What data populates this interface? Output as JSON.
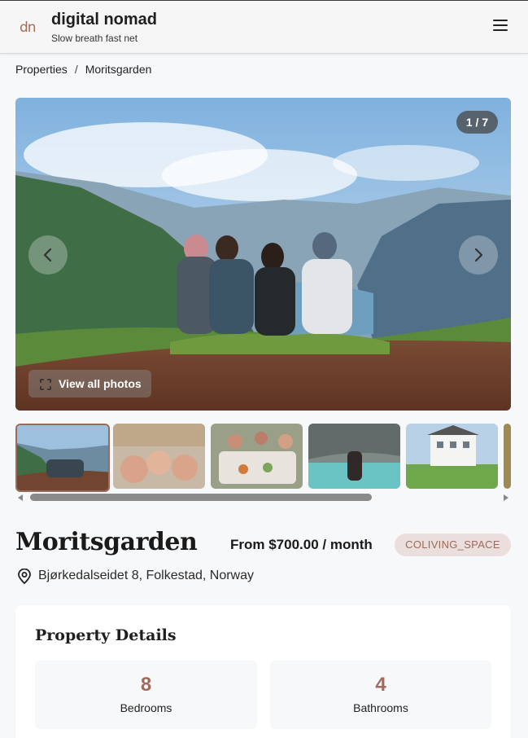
{
  "brand": {
    "logo_text": "dn",
    "name": "digital nomad",
    "tagline": "Slow breath fast net"
  },
  "breadcrumb": {
    "parent": "Properties",
    "separator": "/",
    "current": "Moritsgarden"
  },
  "gallery": {
    "counter": "1 / 7",
    "view_all_label": "View all photos",
    "thumbnails": [
      "mountain-view-group",
      "selfie-group",
      "dinner-table",
      "lake-couple",
      "house-exterior",
      "partial-thumb"
    ]
  },
  "property": {
    "title": "Moritsgarden",
    "price": "From $700.00 / month",
    "type": "COLIVING_SPACE",
    "address": "Bjørkedalseidet 8, Folkestad, Norway"
  },
  "details": {
    "heading": "Property Details",
    "stats": [
      {
        "value": "8",
        "label": "Bedrooms"
      },
      {
        "value": "4",
        "label": "Bathrooms"
      }
    ]
  },
  "colors": {
    "accent": "#9c6a5a",
    "badge_bg": "#eadfdc",
    "page_bg": "#f7f8f9"
  },
  "icons": [
    "menu-icon",
    "chevron-left-icon",
    "chevron-right-icon",
    "expand-icon",
    "location-pin-icon"
  ]
}
